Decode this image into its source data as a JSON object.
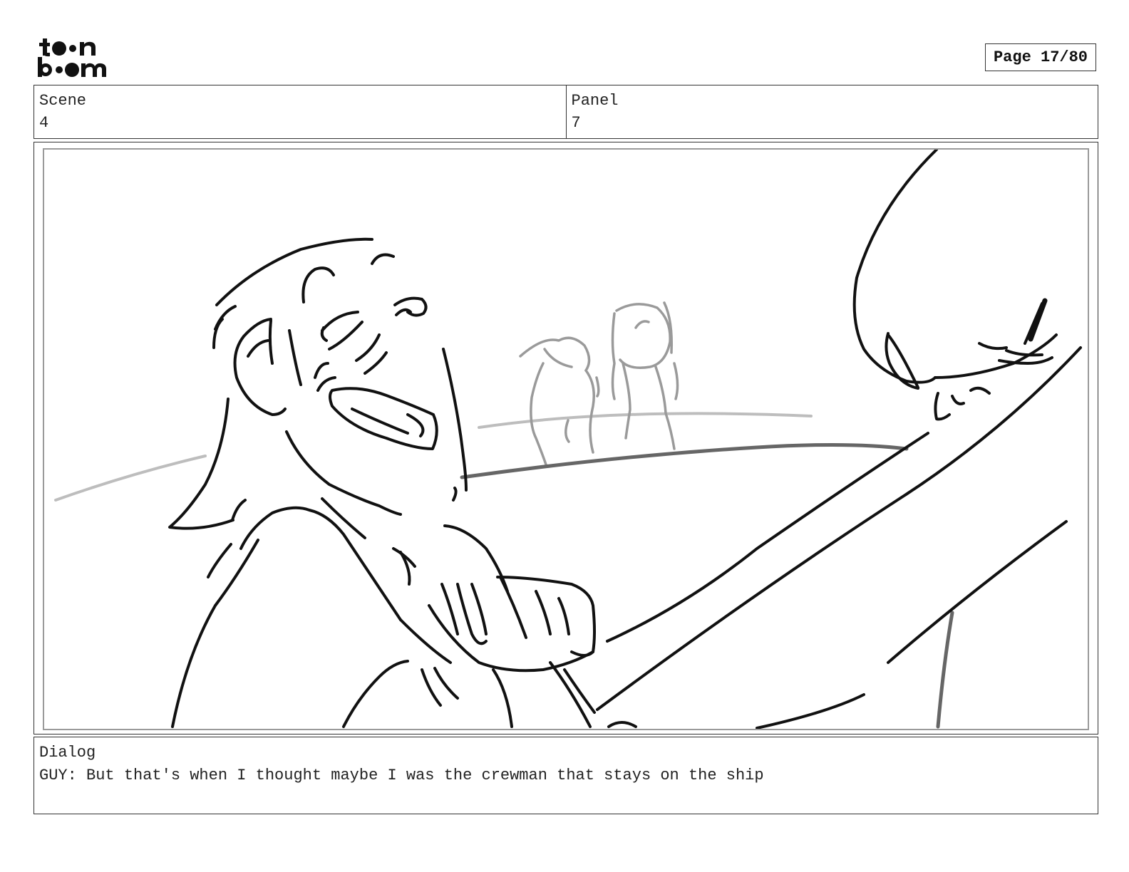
{
  "logo": {
    "line1": "toon",
    "line2": "boom"
  },
  "page": {
    "label": "Page 17/80"
  },
  "scene": {
    "label": "Scene",
    "value": "4"
  },
  "panel": {
    "label": "Panel",
    "value": "7"
  },
  "dialog": {
    "label": "Dialog",
    "text": "GUY: But that's when I thought maybe I was the crewman that stays on the ship"
  },
  "colors": {
    "ink": "#111111",
    "mid_gray": "#666666",
    "light_gray": "#b5b5b5",
    "frame": "#333333"
  },
  "icons": [
    "toonboom-logo",
    "storyboard-sketch"
  ]
}
